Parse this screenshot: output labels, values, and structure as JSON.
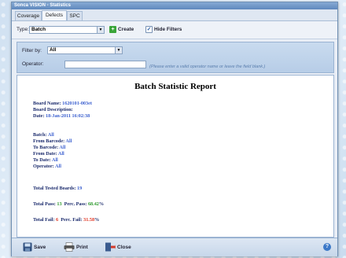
{
  "window": {
    "title": "Sonca VISION - Statistics"
  },
  "tabs": [
    {
      "label": "Coverage"
    },
    {
      "label": "Defects"
    },
    {
      "label": "SPC"
    }
  ],
  "toolbar": {
    "type_label": "Type:",
    "type_value": "Batch",
    "create_label": "Create",
    "hide_filters_label": "Hide Filters"
  },
  "filters": {
    "filter_by_label": "Filter by:",
    "filter_by_value": "All",
    "operator_label": "Operator:",
    "operator_value": "",
    "operator_hint": "(Please enter a valid operator name or leave the field blank.)"
  },
  "report": {
    "title": "Batch Statistic Report",
    "board_name_label": "Board Name:",
    "board_name": "1620101-003et",
    "board_description_label": "Board Description:",
    "date_label": "Date:",
    "date": "18-Jan-2011 16:02:38",
    "batch_label": "Batch:",
    "batch": "All",
    "from_barcode_label": "From Barcode:",
    "from_barcode": "All",
    "to_barcode_label": "To Barcode:",
    "to_barcode": "All",
    "from_date_label": "From Date:",
    "from_date": "All",
    "to_date_label": "To Date:",
    "to_date": "All",
    "operator_label": "Operator:",
    "operator": "All",
    "total_tested_label": "Total Tested Boards:",
    "total_tested": "19",
    "total_pass_label": "Total Pass:",
    "total_pass": "13",
    "perc_pass_label": "Perc. Pass:",
    "perc_pass": "68.42",
    "pct_sign": "%",
    "total_fail_label": "Total Fail:",
    "total_fail": "6",
    "perc_fail_label": "Perc. Fail:",
    "perc_fail": "31.58"
  },
  "bottom": {
    "save_label": "Save",
    "print_label": "Print",
    "close_label": "Close",
    "help_label": "?"
  },
  "colors": {
    "value_blue": "#3a5fcf",
    "pass_green": "#2e9a2e",
    "fail_red": "#e0321e"
  }
}
